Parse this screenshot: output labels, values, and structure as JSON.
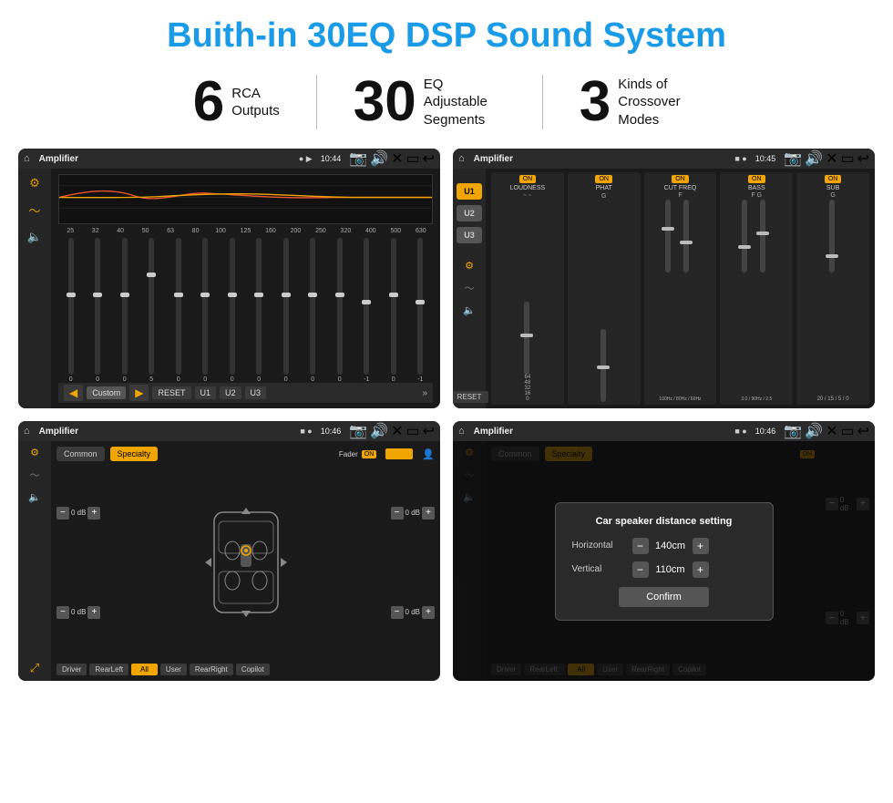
{
  "page": {
    "title": "Buith-in 30EQ DSP Sound System"
  },
  "stats": [
    {
      "number": "6",
      "line1": "RCA",
      "line2": "Outputs"
    },
    {
      "number": "30",
      "line1": "EQ Adjustable",
      "line2": "Segments"
    },
    {
      "number": "3",
      "line1": "Kinds of",
      "line2": "Crossover Modes"
    }
  ],
  "screens": [
    {
      "id": "screen1",
      "topbar": {
        "time": "10:44",
        "title": "Amplifier"
      },
      "eq_labels": [
        "25",
        "32",
        "40",
        "50",
        "63",
        "80",
        "100",
        "125",
        "160",
        "200",
        "250",
        "320",
        "400",
        "500",
        "630"
      ],
      "eq_values": [
        "0",
        "0",
        "0",
        "5",
        "0",
        "0",
        "0",
        "0",
        "0",
        "0",
        "0",
        "-1",
        "0",
        "-1"
      ],
      "preset": "Custom",
      "buttons": [
        "RESET",
        "U1",
        "U2",
        "U3"
      ]
    },
    {
      "id": "screen2",
      "topbar": {
        "time": "10:45",
        "title": "Amplifier"
      },
      "channels": [
        "LOUDNESS",
        "PHAT",
        "CUT FREQ",
        "BASS",
        "SUB"
      ],
      "u_presets": [
        "U1",
        "U2",
        "U3"
      ],
      "reset_label": "RESET"
    },
    {
      "id": "screen3",
      "topbar": {
        "time": "10:46",
        "title": "Amplifier"
      },
      "buttons": [
        "Common",
        "Specialty"
      ],
      "fader_label": "Fader",
      "fader_on": "ON",
      "volume_rows": [
        {
          "label": "",
          "value": "0 dB",
          "value2": "0 dB"
        },
        {
          "label": "",
          "value": "0 dB",
          "value2": "0 dB"
        }
      ],
      "bottom_btns": [
        "Driver",
        "RearLeft",
        "All",
        "User",
        "RearRight",
        "Copilot"
      ]
    },
    {
      "id": "screen4",
      "topbar": {
        "time": "10:46",
        "title": "Amplifier"
      },
      "buttons": [
        "Common",
        "Specialty"
      ],
      "dialog": {
        "title": "Car speaker distance setting",
        "horizontal_label": "Horizontal",
        "horizontal_value": "140cm",
        "vertical_label": "Vertical",
        "vertical_value": "110cm",
        "confirm_label": "Confirm"
      },
      "right_controls": [
        {
          "value": "0 dB"
        },
        {
          "value": "0 dB"
        }
      ],
      "bottom_btns": [
        "Driver",
        "RearLeft.",
        "All",
        "User",
        "RearRight",
        "Copilot"
      ]
    }
  ]
}
